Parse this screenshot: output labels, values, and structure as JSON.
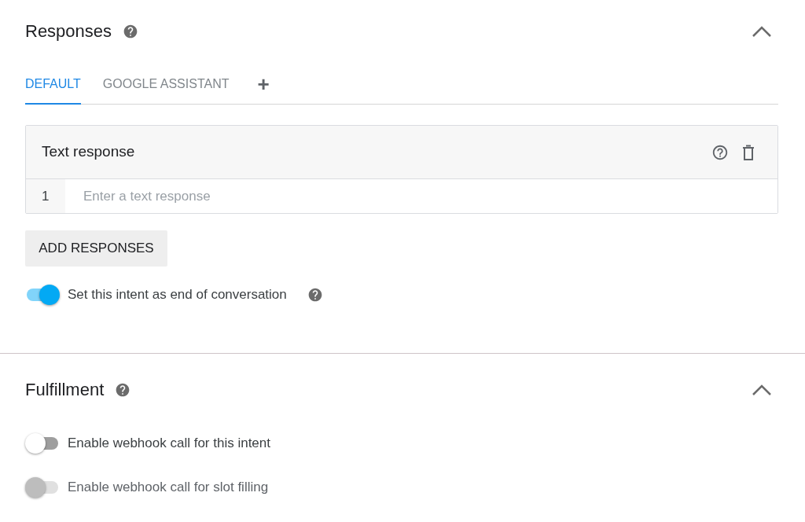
{
  "responses": {
    "title": "Responses",
    "expanded": true,
    "tabs": [
      {
        "label": "DEFAULT",
        "selected": true
      },
      {
        "label": "GOOGLE ASSISTANT",
        "selected": false
      }
    ],
    "add_tab": "+",
    "card": {
      "title": "Text response",
      "rows": [
        {
          "number": "1",
          "placeholder": "Enter a text response"
        }
      ]
    },
    "add_button": "ADD RESPONSES",
    "toggles": [
      {
        "label": "Set this intent as end of conversation",
        "on": true,
        "disabled": false,
        "help": true
      }
    ]
  },
  "fulfillment": {
    "title": "Fulfillment",
    "expanded": true,
    "toggles": [
      {
        "label": "Enable webhook call for this intent",
        "on": false,
        "disabled": false,
        "help": false
      },
      {
        "label": "Enable webhook call for slot filling",
        "on": false,
        "disabled": true,
        "help": false
      }
    ]
  }
}
